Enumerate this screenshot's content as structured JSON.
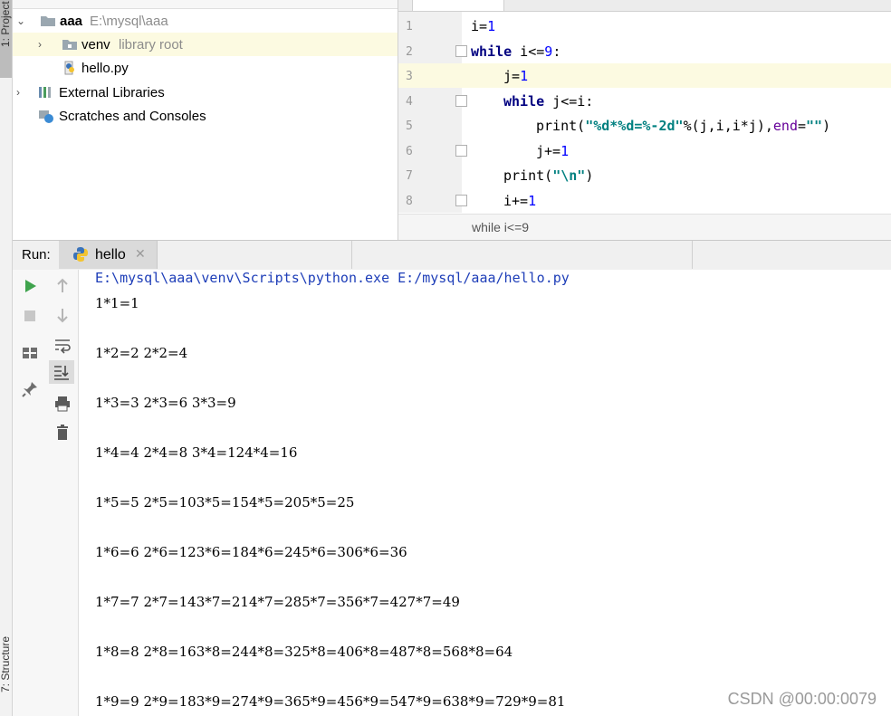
{
  "left_strip": {
    "project_tab": "1: Project",
    "structure_tab": "7: Structure"
  },
  "project_tree": {
    "root": {
      "name": "aaa",
      "path": "E:\\mysql\\aaa"
    },
    "venv": {
      "name": "venv",
      "note": "library root"
    },
    "file": {
      "name": "hello.py"
    },
    "external": {
      "name": "External Libraries"
    },
    "scratches": {
      "name": "Scratches and Consoles"
    }
  },
  "editor": {
    "line_numbers": [
      "1",
      "2",
      "3",
      "4",
      "5",
      "6",
      "7",
      "8"
    ],
    "breadcrumb": "while i<=9"
  },
  "run": {
    "label": "Run:",
    "tab_name": "hello",
    "command": "E:\\mysql\\aaa\\venv\\Scripts\\python.exe E:/mysql/aaa/hello.py",
    "output": [
      "1*1=1",
      "1*2=2 2*2=4",
      "1*3=3 2*3=6 3*3=9",
      "1*4=4 2*4=8 3*4=124*4=16",
      "1*5=5 2*5=103*5=154*5=205*5=25",
      "1*6=6 2*6=123*6=184*6=245*6=306*6=36",
      "1*7=7 2*7=143*7=214*7=285*7=356*7=427*7=49",
      "1*8=8 2*8=163*8=244*8=325*8=406*8=487*8=568*8=64",
      "1*9=9 2*9=183*9=274*9=365*9=456*9=547*9=638*9=729*9=81"
    ]
  },
  "watermark": "CSDN @00:00:0079",
  "colors": {
    "keyword": "#000080",
    "number": "#0000ff",
    "string": "#008080",
    "run_green": "#3fa34d"
  },
  "icons": [
    "folder-icon",
    "python-file-icon",
    "library-icon",
    "scratches-icon",
    "run-icon",
    "stop-icon",
    "layout-icon",
    "pin-icon",
    "up-arrow-icon",
    "down-arrow-icon",
    "soft-wrap-icon",
    "scroll-end-icon",
    "print-icon",
    "trash-icon",
    "python-icon",
    "close-icon"
  ]
}
